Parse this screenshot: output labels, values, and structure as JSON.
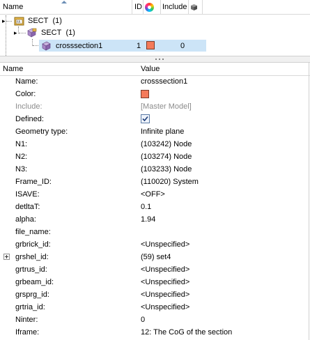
{
  "tree": {
    "headers": {
      "name": "Name",
      "id": "ID",
      "include": "Include"
    },
    "nodes": [
      {
        "label": "SECT",
        "count": "(1)"
      },
      {
        "label": "SECT",
        "count": "(1)"
      },
      {
        "label": "crosssection1",
        "id": "1",
        "include": "0"
      }
    ],
    "colors": {
      "swatch": "#f47a5a",
      "selection": "#cce4f7"
    }
  },
  "props": {
    "headers": {
      "name": "Name",
      "value": "Value"
    },
    "rows": [
      {
        "name": "Name:",
        "value": "crosssection1"
      },
      {
        "name": "Color:",
        "value": ""
      },
      {
        "name": "Include:",
        "value": "[Master Model]"
      },
      {
        "name": "Defined:",
        "value": ""
      },
      {
        "name": "Geometry type:",
        "value": "Infinite plane"
      },
      {
        "name": "N1:",
        "value": "(103242) Node"
      },
      {
        "name": "N2:",
        "value": "(103274) Node"
      },
      {
        "name": "N3:",
        "value": "(103233) Node"
      },
      {
        "name": "Frame_ID:",
        "value": "(110020) System"
      },
      {
        "name": "ISAVE:",
        "value": "<OFF>"
      },
      {
        "name": "detltaT:",
        "value": "0.1"
      },
      {
        "name": "alpha:",
        "value": "1.94"
      },
      {
        "name": "file_name:",
        "value": ""
      },
      {
        "name": "grbrick_id:",
        "value": "<Unspecified>"
      },
      {
        "name": "grshel_id:",
        "value": "(59) set4"
      },
      {
        "name": "grtrus_id:",
        "value": "<Unspecified>"
      },
      {
        "name": "grbeam_id:",
        "value": "<Unspecified>"
      },
      {
        "name": "grsprg_id:",
        "value": "<Unspecified>"
      },
      {
        "name": "grtria_id:",
        "value": "<Unspecified>"
      },
      {
        "name": "Ninter:",
        "value": "0"
      },
      {
        "name": "Iframe:",
        "value": "12: The CoG of the section"
      }
    ]
  }
}
